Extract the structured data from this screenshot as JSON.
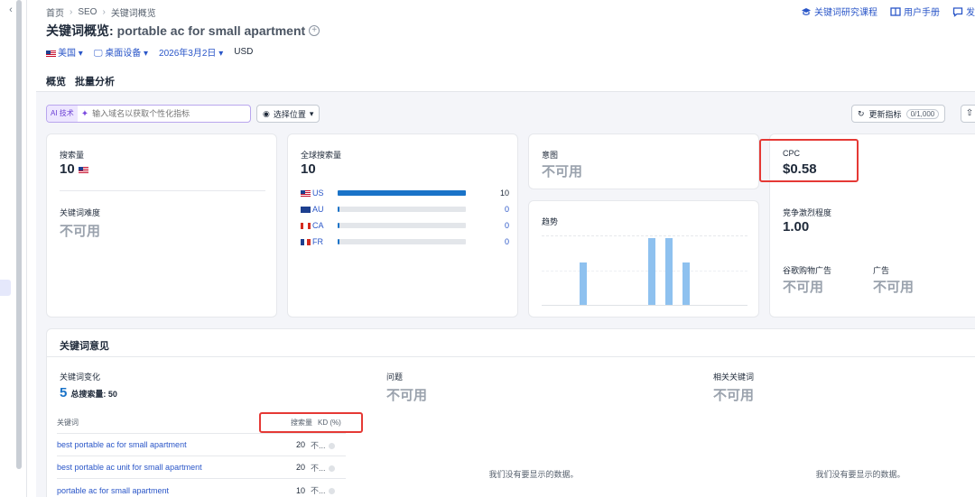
{
  "breadcrumb": {
    "items": [
      "首页",
      "SEO",
      "关键词概览"
    ]
  },
  "top_links": {
    "course": "关键词研究课程",
    "manual": "用户手册",
    "feedback": "发"
  },
  "header": {
    "title": "关键词概览:",
    "keyword": "portable ac for small apartment"
  },
  "filters": {
    "country": "美国",
    "device": "桌面设备",
    "date": "2026年3月2日",
    "currency": "USD"
  },
  "tabs": [
    {
      "label": "概览"
    },
    {
      "label": "批量分析"
    }
  ],
  "toolbar": {
    "ai_tag": "AI 技术",
    "ai_placeholder": "输入域名以获取个性化指标",
    "location": "选择位置",
    "refresh": "更新指标",
    "refresh_count": "0/1,000"
  },
  "volume": {
    "label": "搜索量",
    "value": "10",
    "kd_label": "关键词难度",
    "kd_value": "不可用"
  },
  "global": {
    "label": "全球搜索量",
    "value": "10",
    "countries": [
      {
        "code": "US",
        "value": "10",
        "share": 1.0
      },
      {
        "code": "AU",
        "value": "0",
        "share": 0
      },
      {
        "code": "CA",
        "value": "0",
        "share": 0
      },
      {
        "code": "FR",
        "value": "0",
        "share": 0
      }
    ]
  },
  "intent": {
    "label": "意图",
    "value": "不可用"
  },
  "trend": {
    "label": "趋势",
    "values": [
      0.6,
      0,
      0,
      0,
      0.95,
      0.95,
      0.6,
      0,
      0,
      0,
      0,
      0
    ]
  },
  "cpc": {
    "label": "CPC",
    "value": "$0.58",
    "competition_label": "竞争激烈程度",
    "competition_value": "1.00",
    "shopping_label": "谷歌购物广告",
    "shopping_value": "不可用",
    "ads_label": "广告",
    "ads_value": "不可用"
  },
  "ideas": {
    "title": "关键词意见",
    "variations_label": "关键词变化",
    "variations_count": "5",
    "total_volume": "总搜索量: 50",
    "questions_label": "问题",
    "questions_value": "不可用",
    "related_label": "相关关键词",
    "related_value": "不可用",
    "no_data": "我们没有要显示的数据。",
    "table_headers": {
      "keyword": "关键词",
      "volume": "搜索量",
      "kd": "KD (%)"
    },
    "rows": [
      {
        "keyword": "best portable ac for small apartment",
        "volume": "20",
        "kd": "不..."
      },
      {
        "keyword": "best portable ac unit for small apartment",
        "volume": "20",
        "kd": "不..."
      },
      {
        "keyword": "portable ac for small apartment",
        "volume": "10",
        "kd": "不..."
      }
    ]
  },
  "colors": {
    "accent": "#1a73c8",
    "highlight": "#e53935",
    "trend_bar": "#8ec1ef"
  }
}
